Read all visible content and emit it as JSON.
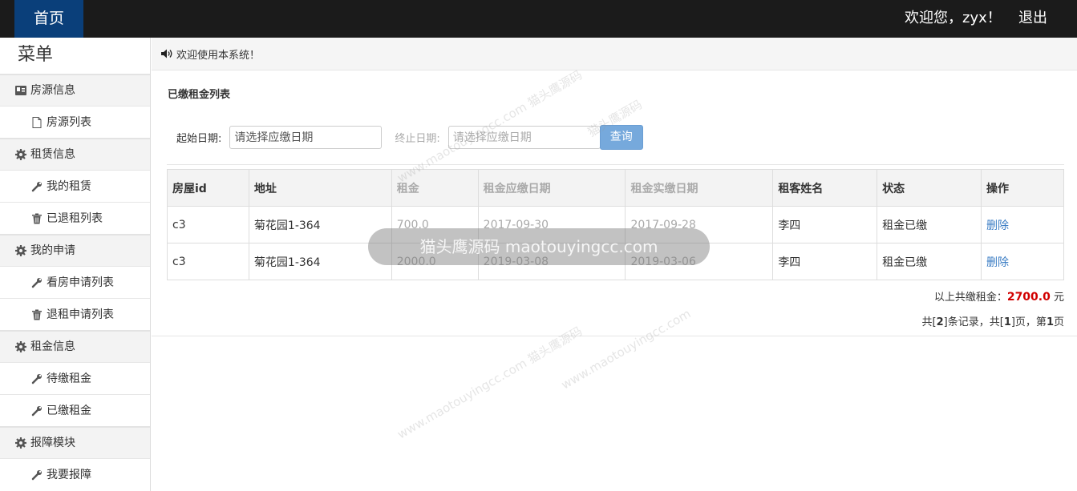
{
  "topbar": {
    "home_label": "首页",
    "welcome": "欢迎您，zyx！",
    "logout_label": "退出"
  },
  "sidebar": {
    "title": "菜单",
    "groups": [
      {
        "label": "房源信息",
        "icon": "id-card-icon",
        "items": [
          {
            "label": "房源列表",
            "icon": "file-icon"
          }
        ]
      },
      {
        "label": "租赁信息",
        "icon": "gear-icon",
        "items": [
          {
            "label": "我的租赁",
            "icon": "wrench-icon"
          },
          {
            "label": "已退租列表",
            "icon": "trash-icon"
          }
        ]
      },
      {
        "label": "我的申请",
        "icon": "gear-icon",
        "items": [
          {
            "label": "看房申请列表",
            "icon": "wrench-icon"
          },
          {
            "label": "退租申请列表",
            "icon": "trash-icon"
          }
        ]
      },
      {
        "label": "租金信息",
        "icon": "gear-icon",
        "items": [
          {
            "label": "待缴租金",
            "icon": "wrench-icon"
          },
          {
            "label": "已缴租金",
            "icon": "wrench-icon"
          }
        ]
      },
      {
        "label": "报障模块",
        "icon": "gear-icon",
        "items": [
          {
            "label": "我要报障",
            "icon": "wrench-icon"
          }
        ]
      }
    ]
  },
  "notice": {
    "text": "欢迎使用本系统！",
    "icon": "volume-icon"
  },
  "main": {
    "title": "已缴租金列表",
    "filter": {
      "start_label": "起始日期:",
      "start_placeholder": "请选择应缴日期",
      "end_label": "终止日期:",
      "end_placeholder": "请选择应缴日期",
      "query_label": "查询"
    },
    "table": {
      "headers": [
        "房屋id",
        "地址",
        "租金",
        "租金应缴日期",
        "租金实缴日期",
        "租客姓名",
        "状态",
        "操作"
      ],
      "rows": [
        [
          "c3",
          "菊花园1-364",
          "700.0",
          "2017-09-30",
          "2017-09-28",
          "李四",
          "租金已缴",
          "删除"
        ],
        [
          "c3",
          "菊花园1-364",
          "2000.0",
          "2019-03-08",
          "2019-03-06",
          "李四",
          "租金已缴",
          "删除"
        ]
      ]
    },
    "summary": {
      "prefix": "以上共缴租金：",
      "amount": "2700.0",
      "suffix": " 元"
    },
    "pager": {
      "p1": "共[",
      "total": "2",
      "p2": "]条记录，共[",
      "pages": "1",
      "p3": "]页，第",
      "current": "1",
      "p4": "页"
    }
  },
  "watermark": {
    "overlay_text": "猫头鹰源码 maotouyingcc.com",
    "text": "猫头鹰源码",
    "url": "www.maotouyingcc.com"
  }
}
